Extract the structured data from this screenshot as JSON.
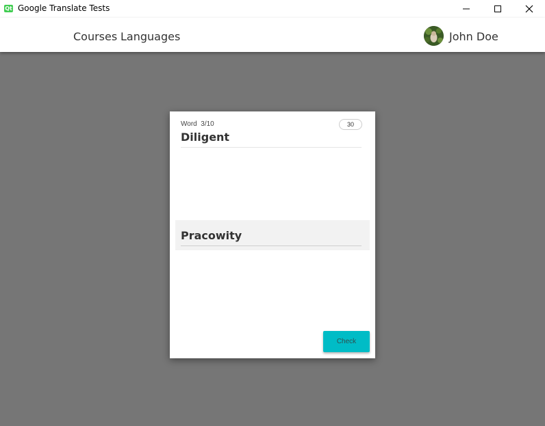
{
  "window": {
    "title": "Google Translate Tests",
    "app_icon": "qt-icon",
    "controls": [
      "minimize-icon",
      "maximize-icon",
      "close-icon"
    ]
  },
  "header": {
    "nav": [
      {
        "label": "Courses"
      },
      {
        "label": "Languages"
      }
    ],
    "user": {
      "name": "John Doe",
      "avatar": "avatar-image"
    }
  },
  "card": {
    "counter_label": "Word  3/10",
    "timer": "30",
    "word": "Diligent",
    "answer": "Pracowity",
    "check_label": "Check"
  },
  "colors": {
    "background": "#767676",
    "accent": "#00bcc6",
    "qt_green": "#41cd52",
    "answer_band": "#f2f2f2"
  }
}
